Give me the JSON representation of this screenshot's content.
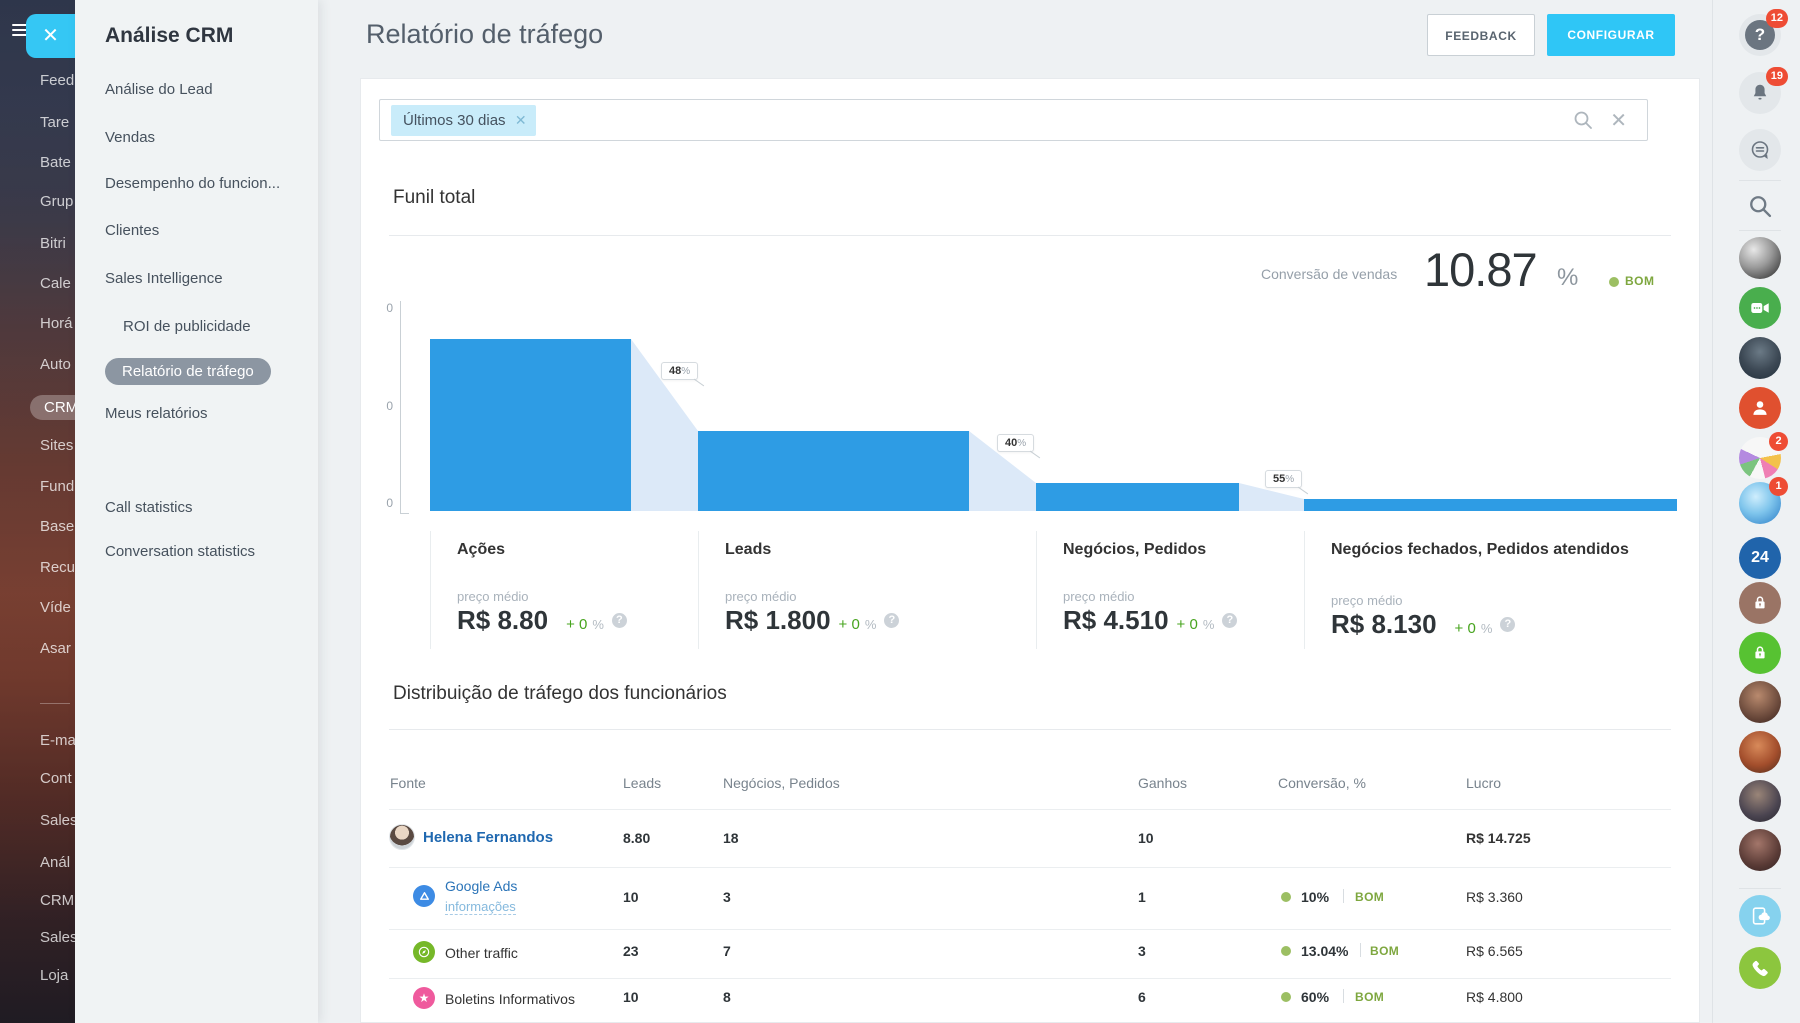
{
  "left_rail": {
    "items": [
      {
        "label": "Feed"
      },
      {
        "label": "Tare"
      },
      {
        "label": "Bate"
      },
      {
        "label": "Grup"
      },
      {
        "label": "Bitri"
      },
      {
        "label": "Cale"
      },
      {
        "label": "Horá"
      },
      {
        "label": "Auto"
      },
      {
        "label": "CRM",
        "active": true
      },
      {
        "label": "Sites"
      },
      {
        "label": "Fund"
      },
      {
        "label": "Base"
      },
      {
        "label": "Recu"
      },
      {
        "label": "Víde"
      },
      {
        "label": "Asar"
      },
      {
        "divider": true
      },
      {
        "label": "E-ma"
      },
      {
        "label": "Cont"
      },
      {
        "label": "Sales"
      },
      {
        "label": "Anál"
      },
      {
        "label": "CRM"
      },
      {
        "label": "Sales"
      },
      {
        "label": "Loja"
      }
    ]
  },
  "flyout": {
    "title": "Análise CRM",
    "items": [
      {
        "label": "Análise do Lead"
      },
      {
        "label": "Vendas"
      },
      {
        "label": "Desempenho do funcion..."
      },
      {
        "label": "Clientes"
      },
      {
        "label": "Sales Intelligence"
      },
      {
        "label": "ROI de publicidade",
        "nested": true
      },
      {
        "label": "Relatório de tráfego",
        "nested": true,
        "active": true
      },
      {
        "label": "Meus relatórios"
      },
      {
        "label": "Call statistics"
      },
      {
        "label": "Conversation statistics"
      }
    ]
  },
  "header": {
    "title": "Relatório de tráfego",
    "feedback_label": "FEEDBACK",
    "configure_label": "CONFIGURAR"
  },
  "filter": {
    "chip_label": "Últimos 30 dias"
  },
  "funnel": {
    "section_title": "Funil total",
    "conversion_label": "Conversão de vendas",
    "conversion_value": "10.87",
    "conversion_unit": "%",
    "conversion_status": "BOM",
    "axis_ticks": [
      "0",
      "0",
      "0"
    ],
    "help_glyph": "?",
    "transitions": [
      {
        "value": "48",
        "unit": "%"
      },
      {
        "value": "40",
        "unit": "%"
      },
      {
        "value": "55",
        "unit": "%"
      }
    ],
    "stages": [
      {
        "label": "Ações",
        "price_label": "preço médio",
        "price": "R$ 8.80",
        "delta": "+ 0",
        "delta_unit": "%"
      },
      {
        "label": "Leads",
        "price_label": "preço médio",
        "price": "R$ 1.800",
        "delta": "+ 0",
        "delta_unit": "%"
      },
      {
        "label": "Negócios, Pedidos",
        "price_label": "preço médio",
        "price": "R$ 4.510",
        "delta": "+ 0",
        "delta_unit": "%"
      },
      {
        "label": "Negócios fechados, Pedidos atendidos",
        "price_label": "preço médio",
        "price": "R$ 8.130",
        "delta": "+ 0",
        "delta_unit": "%"
      }
    ]
  },
  "table": {
    "section_title": "Distribuição de tráfego dos funcionários",
    "columns": [
      "Fonte",
      "Leads",
      "Negócios, Pedidos",
      "Ganhos",
      "Conversão, %",
      "Lucro"
    ],
    "rows": [
      {
        "name": "Helena Fernandos",
        "leads": "8.80",
        "deals": "18",
        "won": "10",
        "conversion": "",
        "status": "",
        "profit": "R$ 14.725"
      },
      {
        "name": "Google Ads",
        "sub": "informações",
        "leads": "10",
        "deals": "3",
        "won": "1",
        "conversion": "10%",
        "status": "BOM",
        "profit": "R$ 3.360"
      },
      {
        "name": "Other traffic",
        "leads": "23",
        "deals": "7",
        "won": "3",
        "conversion": "13.04%",
        "status": "BOM",
        "profit": "R$ 6.565"
      },
      {
        "name": "Boletins Informativos",
        "leads": "10",
        "deals": "8",
        "won": "6",
        "conversion": "60%",
        "status": "BOM",
        "profit": "R$ 4.800"
      }
    ]
  },
  "right_rail": {
    "help_glyph": "?",
    "logo_label": "24",
    "badges": {
      "help": "12",
      "bell": "19",
      "collage": "2",
      "globe": "1"
    }
  },
  "chart_data": {
    "type": "bar",
    "subtype": "funnel",
    "categories": [
      "Ações",
      "Leads",
      "Negócios, Pedidos",
      "Negócios fechados, Pedidos atendidos"
    ],
    "relative_heights": [
      1.0,
      0.47,
      0.16,
      0.07
    ],
    "transition_percents": [
      48,
      40,
      55
    ],
    "avg_prices": [
      "R$ 8.80",
      "R$ 1.800",
      "R$ 4.510",
      "R$ 8.130"
    ],
    "total_conversion_percent": 10.87,
    "status": "BOM",
    "title": "Funil total",
    "accent_color": "#2e9ce4"
  }
}
